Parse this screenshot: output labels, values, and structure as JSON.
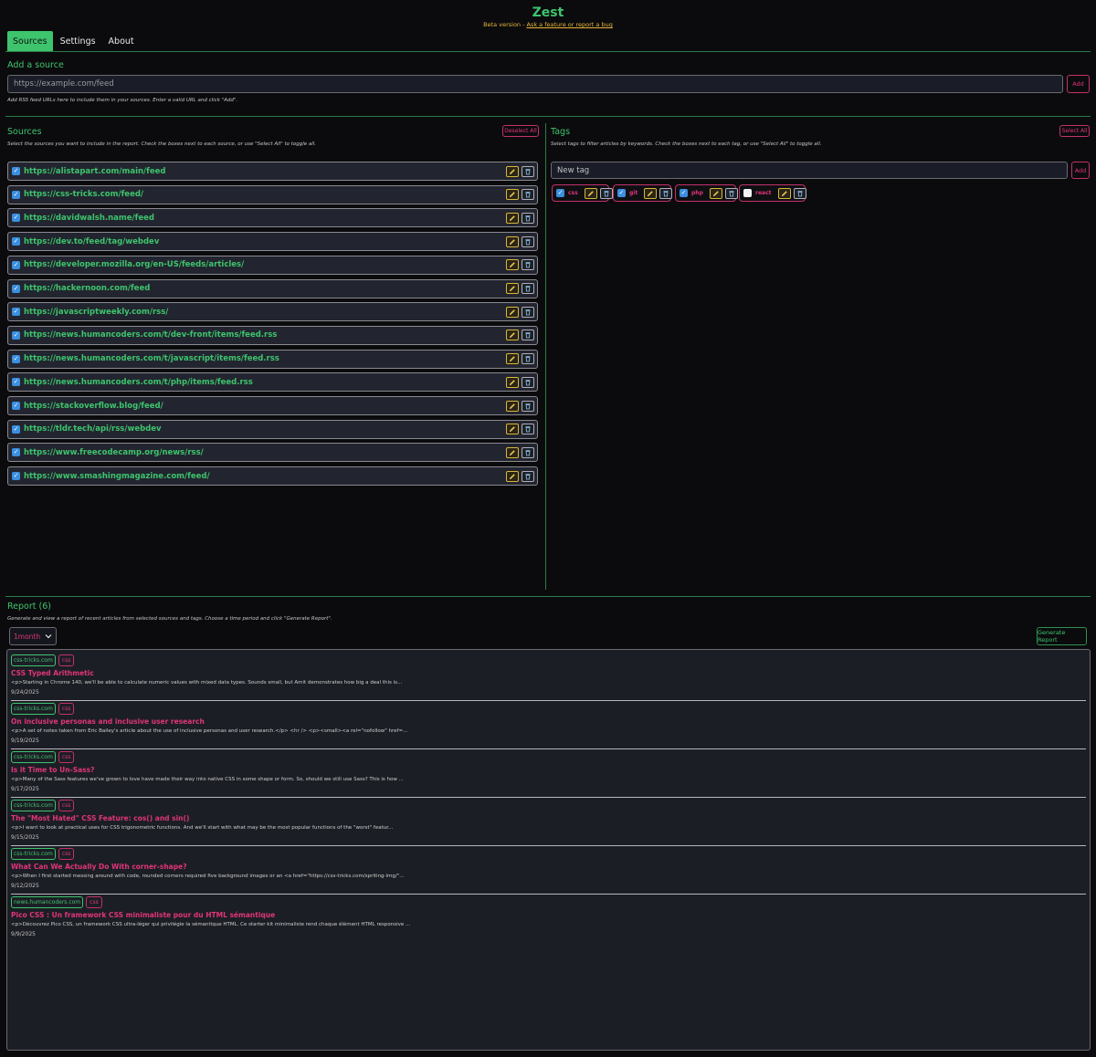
{
  "header": {
    "title": "Zest",
    "subtitle_prefix": "Beta version - ",
    "subtitle_link": "Ask a feature or report a bug"
  },
  "tabs": [
    {
      "label": "Sources",
      "active": true
    },
    {
      "label": "Settings",
      "active": false
    },
    {
      "label": "About",
      "active": false
    }
  ],
  "add_source": {
    "title": "Add a source",
    "placeholder": "https://example.com/feed",
    "button": "Add",
    "help": "Add RSS feed URLs here to include them in your sources. Enter a valid URL and click \"Add\"."
  },
  "sources": {
    "title": "Sources",
    "toggle_button": "Deselect All",
    "help": "Select the sources you want to include in the report. Check the boxes next to each source, or use \"Select All\" to toggle all.",
    "items": [
      {
        "url": "https://alistapart.com/main/feed",
        "checked": true
      },
      {
        "url": "https://css-tricks.com/feed/",
        "checked": true
      },
      {
        "url": "https://davidwalsh.name/feed",
        "checked": true
      },
      {
        "url": "https://dev.to/feed/tag/webdev",
        "checked": true
      },
      {
        "url": "https://developer.mozilla.org/en-US/feeds/articles/",
        "checked": true
      },
      {
        "url": "https://hackernoon.com/feed",
        "checked": true
      },
      {
        "url": "https://javascriptweekly.com/rss/",
        "checked": true
      },
      {
        "url": "https://news.humancoders.com/t/dev-front/items/feed.rss",
        "checked": true
      },
      {
        "url": "https://news.humancoders.com/t/javascript/items/feed.rss",
        "checked": true
      },
      {
        "url": "https://news.humancoders.com/t/php/items/feed.rss",
        "checked": true
      },
      {
        "url": "https://stackoverflow.blog/feed/",
        "checked": true
      },
      {
        "url": "https://tldr.tech/api/rss/webdev",
        "checked": true
      },
      {
        "url": "https://www.freecodecamp.org/news/rss/",
        "checked": true
      },
      {
        "url": "https://www.smashingmagazine.com/feed/",
        "checked": true
      }
    ]
  },
  "tags": {
    "title": "Tags",
    "toggle_button": "Select All",
    "help": "Select tags to filter articles by keywords. Check the boxes next to each tag, or use \"Select All\" to toggle all.",
    "placeholder": "New tag",
    "add_button": "Add",
    "items": [
      {
        "name": "css",
        "checked": true
      },
      {
        "name": "git",
        "checked": true
      },
      {
        "name": "php",
        "checked": true
      },
      {
        "name": "react",
        "checked": false
      }
    ]
  },
  "report": {
    "title": "Report (6)",
    "help": "Generate and view a report of recent articles from selected sources and tags. Choose a time period and click \"Generate Report\".",
    "period": "1month",
    "generate_button": "Generate Report",
    "articles": [
      {
        "source": "css-tricks.com",
        "tag": "css",
        "title": "CSS Typed Arithmetic",
        "excerpt": "<p>Starting in Chrome 140, we'll be able to calculate numeric values with mixed data types. Sounds small, but Amit demonstrates how big a deal this is...",
        "date": "9/24/2025"
      },
      {
        "source": "css-tricks.com",
        "tag": "css",
        "title": "On inclusive personas and inclusive user research",
        "excerpt": "<p>A set of notes taken from Eric Bailey's article about the use of inclusive personas and user research.</p> <hr /> <p><small><a rel=\"nofollow\" href=...",
        "date": "9/19/2025"
      },
      {
        "source": "css-tricks.com",
        "tag": "css",
        "title": "Is it Time to Un-Sass?",
        "excerpt": "<p>Many of the Sass features we've grown to love have made their way into native CSS in some shape or form. So, should we still use Sass? This is how ...",
        "date": "9/17/2025"
      },
      {
        "source": "css-tricks.com",
        "tag": "css",
        "title": "The \"Most Hated\" CSS Feature: cos() and sin()",
        "excerpt": "<p>I want to look at practical uses for CSS trigonometric functions. And we'll start with what may be the most popular functions of the \"worst\" featur...",
        "date": "9/15/2025"
      },
      {
        "source": "css-tricks.com",
        "tag": "css",
        "title": "What Can We Actually Do With corner-shape?",
        "excerpt": "<p>When I first started messing around with code, rounded corners required five background images or an <a href=\"https://css-tricks.com/spriting-img/\"...",
        "date": "9/12/2025"
      },
      {
        "source": "news.humancoders.com",
        "tag": "css",
        "title": "Pico CSS : Un framework CSS minimaliste pour du HTML sémantique",
        "excerpt": "<p>Découvrez Pico CSS, un framework CSS ultra-léger qui privilégie la sémantique HTML. Ce starter kit minimaliste rend chaque élément HTML responsive ...",
        "date": "9/9/2025"
      }
    ]
  },
  "icons": {
    "edit": "pencil-icon",
    "delete": "trash-icon",
    "check": "checkmark-icon",
    "chevron": "chevron-down-icon"
  },
  "colors": {
    "accent_green": "#3ec46d",
    "accent_pink": "#e0357a",
    "edit_yellow": "#d9b53a",
    "background": "#0b0b0d"
  }
}
